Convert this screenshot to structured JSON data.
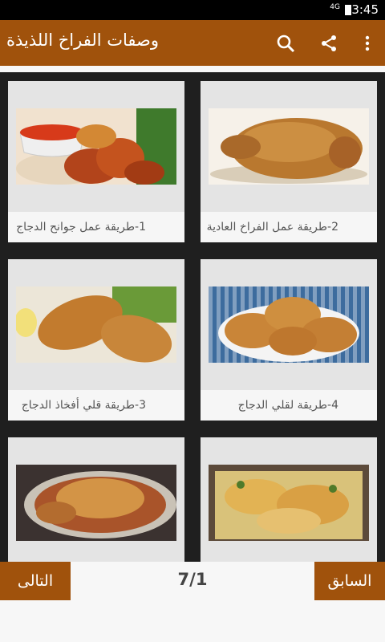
{
  "status_bar": {
    "network": "4G",
    "time": "3:45"
  },
  "app_bar": {
    "title": "وصفات الفراخ اللذيذة",
    "icons": [
      "search-icon",
      "share-icon",
      "more-vert-icon"
    ],
    "color": "#a0520c"
  },
  "cards": [
    {
      "caption": "1-طريقة عمل جوانح الدجاج",
      "image": "chicken-wings-with-sauce"
    },
    {
      "caption": "2-طريقة عمل الفراخ العادية",
      "image": "roast-whole-chicken"
    },
    {
      "caption": "3-طريقة قلي أفخاذ الدجاج",
      "image": "fried-chicken-legs"
    },
    {
      "caption": "4-طريقة لقلي الدجاج",
      "image": "fried-chicken-plate"
    },
    {
      "caption": "",
      "image": "chicken-in-glass-dish"
    },
    {
      "caption": "",
      "image": "chicken-potato-bake"
    }
  ],
  "pagination": {
    "next_label": "التالى",
    "prev_label": "السابق",
    "page_indicator": "7/1"
  }
}
